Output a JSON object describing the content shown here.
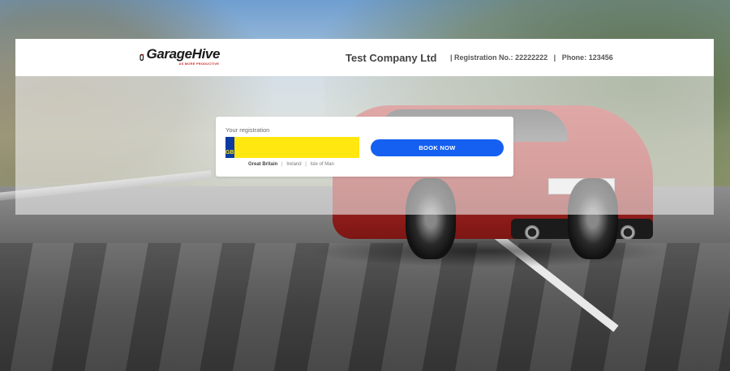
{
  "brand": {
    "logo_text": "GarageHive",
    "logo_tagline": "AS MORE PRODUCTIVE"
  },
  "header": {
    "company_name": "Test Company Ltd",
    "registration_label": "Registration No.:",
    "registration_number": "22222222",
    "phone_label": "Phone:",
    "phone_number": "123456",
    "separator": "|"
  },
  "booking": {
    "registration_label": "Your registration",
    "plate_country_code": "GB",
    "plate_value": "",
    "countries": [
      "Great Britain",
      "Ireland",
      "Isle of Man"
    ],
    "selected_country": "Great Britain",
    "book_button_label": "BOOK NOW"
  },
  "colors": {
    "plate_yellow": "#ffe70f",
    "plate_band_blue": "#0b3aa2",
    "button_blue": "#1560f0",
    "logo_red": "#d0282a"
  }
}
